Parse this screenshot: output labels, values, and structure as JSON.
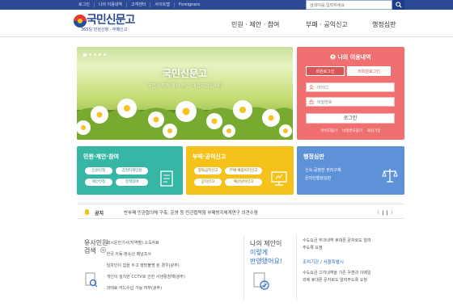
{
  "top_util": {
    "links": [
      "로그인",
      "나의 이용내역",
      "고객센터",
      "사이트맵",
      "Foreigners"
    ],
    "search_placeholder": "검색어를 입력하세요"
  },
  "header": {
    "logo_text": "국민신문고",
    "logo_sub": "365일 민원신청 · 부패신고",
    "gnb": [
      "민원 · 제안 · 참여",
      "부패 · 공익신고",
      "행정심판"
    ]
  },
  "banner": {
    "title": "국민신문고",
    "subtitle": "국민의 입장에서 듣고 해결하겠습니다"
  },
  "login": {
    "title": "나의 이용내역",
    "tab_member": "회원로그인",
    "tab_nonmember": "비회원로그인",
    "id_placeholder": "아이디",
    "pw_placeholder": "비밀번호",
    "button": "로그인",
    "links": [
      "아이디찾기",
      "비밀번호찾기",
      "회원가입"
    ]
  },
  "panels": {
    "civil": {
      "title": "민원·제안·참여",
      "chips": [
        "민원신청",
        "갑질피해민원",
        "제안신청",
        "정책참여"
      ]
    },
    "corruption": {
      "title": "부패·공익신고",
      "chips": [
        "청탁금지신고",
        "부패·채용비리신고",
        "공익신고",
        "예산낭비신고"
      ]
    },
    "appeal": {
      "title": "행정심판",
      "lines": [
        "신속·공정한 권리구제",
        "온라인행정심판"
      ]
    }
  },
  "notice": {
    "label": "공지",
    "text": "반부패 민관협의체 구축, 운영 등 민관협력형 부패방지체계연구 의견수렴",
    "controls": "〈  ❙❙  〉"
  },
  "similar": {
    "title_line1": "유사민원",
    "title_line2": "검색",
    "items": [
      "택시운전기사(지역별) 소득자료",
      "한국 아동·청소년 패널조사",
      "임차인이 집을 두고 행방불명 된 경우(광주)",
      "개인이 설치한 CCTV로 인한 사생활침해(광주)",
      "과태료 카드수납 가능 여부(광주)"
    ]
  },
  "proposal": {
    "line1": "나의 제안이",
    "line2": "이렇게",
    "line3": "반영됐어요!"
  },
  "right_news": {
    "lines_top": [
      "수도요금 부과내역 휴대폰 문자로도 알려",
      "주도록 요청"
    ],
    "label": "조치기관 / 서울특별시",
    "lines_bottom": [
      "수도요금 고지내역을 기존 우편과 이메일",
      "외에 휴대폰 문자로도 알려주도록 요청"
    ]
  },
  "colors": {
    "brand_blue": "#2c4a94",
    "login_red": "#f06f70",
    "teal": "#37b6a6",
    "yellow": "#f4c21a",
    "blue": "#5d92d8"
  }
}
